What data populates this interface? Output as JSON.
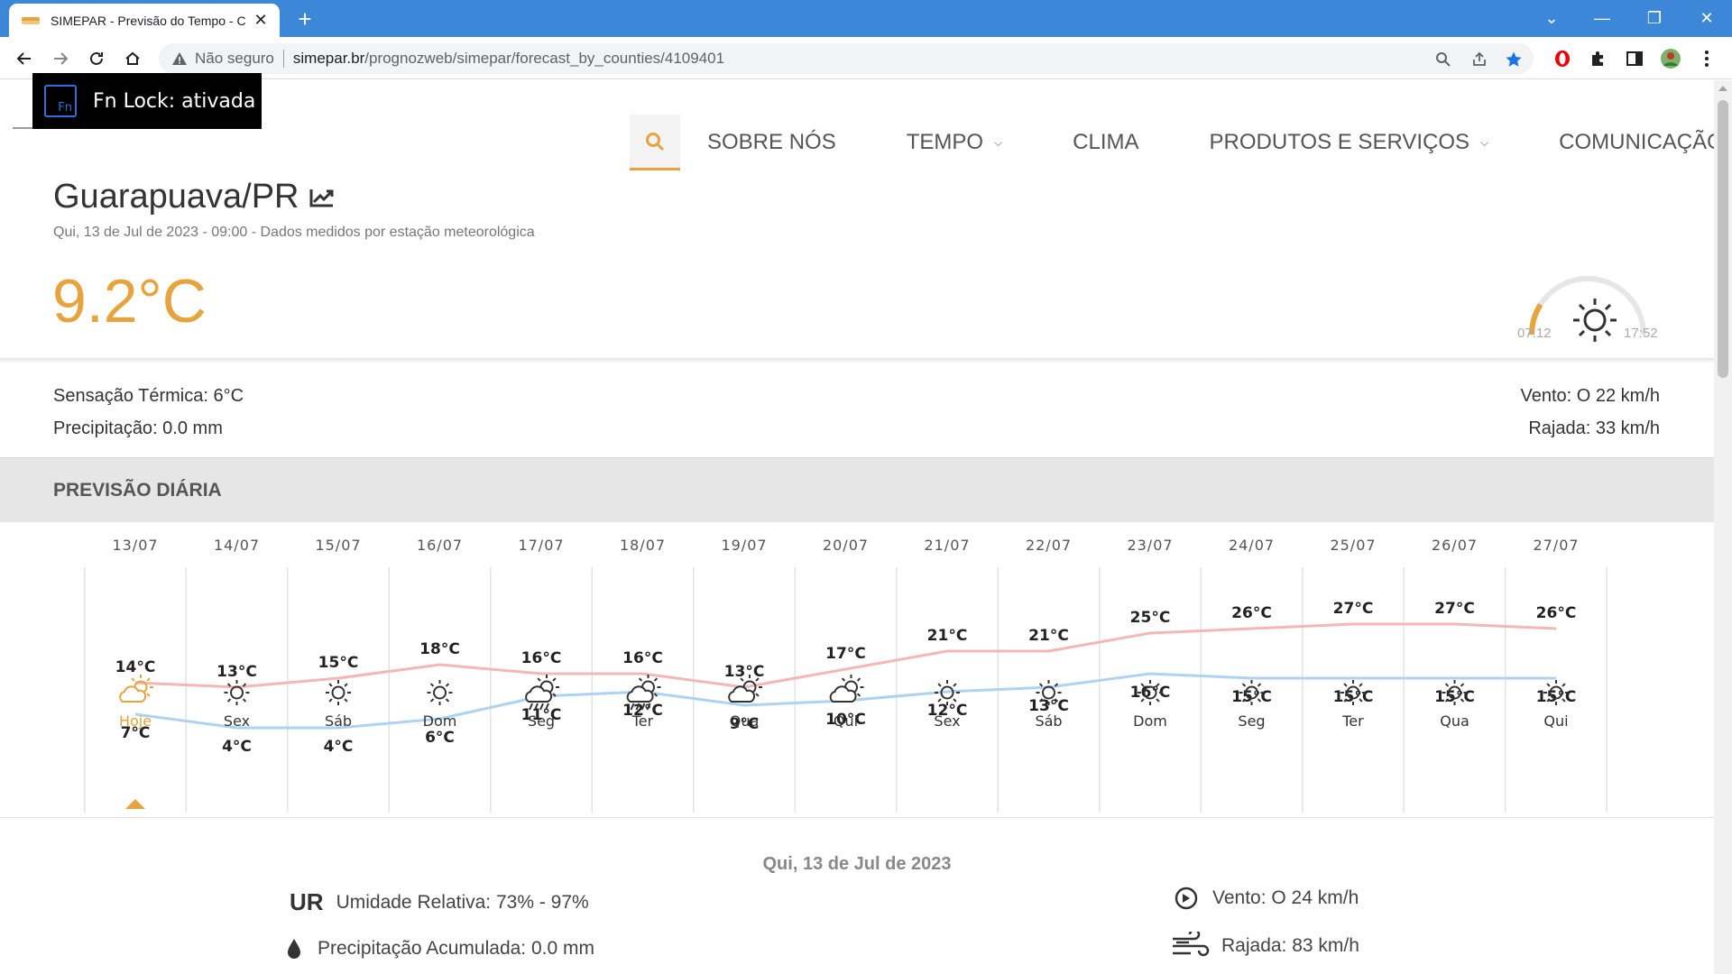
{
  "browser": {
    "tab_title": "SIMEPAR - Previsão do Tempo - C",
    "not_secure": "Não seguro",
    "url_host": "simepar.br",
    "url_path": "/prognozweb/simepar/forecast_by_counties/4109401"
  },
  "overlay": {
    "fn_label": "Fn",
    "fn_lock": "Fn Lock: ativada"
  },
  "nav": {
    "items": [
      "SOBRE NÓS",
      "TEMPO",
      "CLIMA",
      "PRODUTOS E SERVIÇOS",
      "COMUNICAÇÃO"
    ],
    "has_dropdown": [
      false,
      true,
      false,
      true,
      true
    ]
  },
  "current": {
    "city": "Guarapuava/PR",
    "subtitle": "Qui, 13 de Jul de 2023 - 09:00 - Dados medidos por estação meteorológica",
    "temperature": "9.2°C",
    "sunrise": "07:12",
    "sunset": "17:52",
    "day_progress": 0.18,
    "feels_like": "Sensação Térmica: 6°C",
    "precipitation": "Precipitação: 0.0 mm",
    "wind": "Vento: O 22 km/h",
    "gust": "Rajada: 33 km/h"
  },
  "section": {
    "title": "PREVISÃO DIÁRIA"
  },
  "colors": {
    "accent": "#e6a33e",
    "max_line": "#f4b6b6",
    "min_line": "#aed3f2"
  },
  "chart_data": {
    "type": "line",
    "categories": [
      "13/07",
      "14/07",
      "15/07",
      "16/07",
      "17/07",
      "18/07",
      "19/07",
      "20/07",
      "21/07",
      "22/07",
      "23/07",
      "24/07",
      "25/07",
      "26/07",
      "27/07"
    ],
    "weekdays": [
      "Hoje",
      "Sex",
      "Sáb",
      "Dom",
      "Seg",
      "Ter",
      "Qua",
      "Qui",
      "Sex",
      "Sáb",
      "Dom",
      "Seg",
      "Ter",
      "Qua",
      "Qui"
    ],
    "icons": [
      "partly-sunny-icon",
      "sun-icon",
      "sun-icon",
      "sun-icon",
      "rain-sun-icon",
      "rain-sun-icon",
      "cloud-sun-icon",
      "cloud-sun-icon",
      "sun-icon",
      "sun-icon",
      "sun-icon",
      "sun-icon",
      "sun-icon",
      "sun-icon",
      "sun-icon"
    ],
    "series": [
      {
        "values": [
          14,
          13,
          15,
          18,
          16,
          16,
          13,
          17,
          21,
          21,
          25,
          26,
          27,
          27,
          26
        ]
      },
      {
        "values": [
          7,
          4,
          4,
          6,
          11,
          12,
          9,
          10,
          12,
          13,
          16,
          15,
          15,
          15,
          15
        ]
      }
    ],
    "unit": "°C",
    "selected_index": 0
  },
  "detail": {
    "date": "Qui, 13 de Jul de 2023",
    "ur_label": "UR",
    "humidity": "Umidade Relativa: 73% - 97%",
    "precip_acc": "Precipitação Acumulada: 0.0 mm",
    "wind": "Vento: O 24 km/h",
    "gust": "Rajada: 83 km/h"
  }
}
